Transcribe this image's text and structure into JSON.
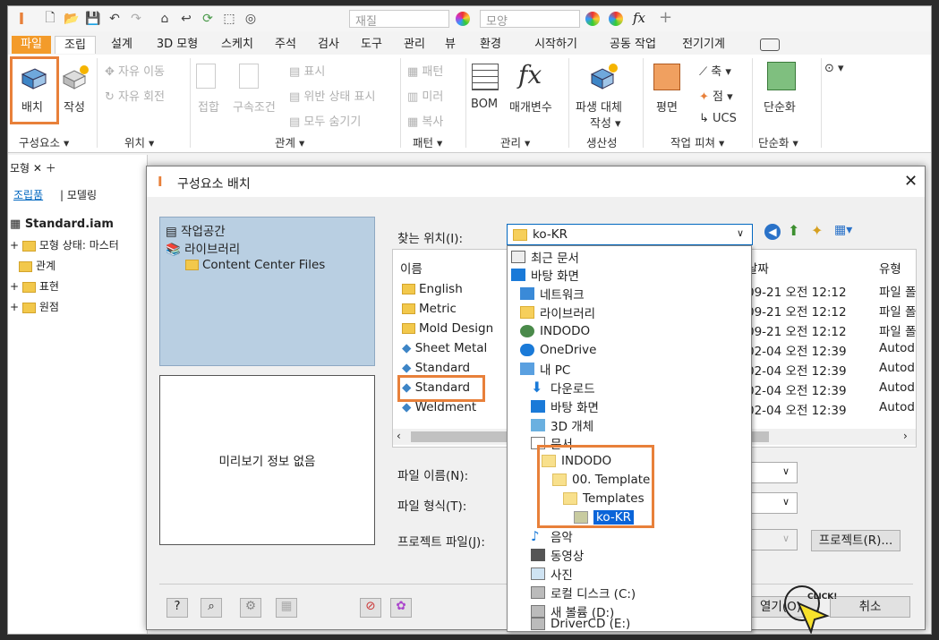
{
  "qat": {
    "material_placeholder": "재질",
    "appearance_placeholder": "모양"
  },
  "tabs": [
    "파일",
    "조립",
    "설계",
    "3D 모형",
    "스케치",
    "주석",
    "검사",
    "도구",
    "관리",
    "뷰",
    "환경",
    "시작하기",
    "공동 작업",
    "전기기계"
  ],
  "ribbon": {
    "place": "배치",
    "create": "작성",
    "free_move": "자유 이동",
    "free_rotate": "자유 회전",
    "joint": "접합",
    "constrain": "구속조건",
    "show": "표시",
    "show_sick": "위반 상태 표시",
    "hide_all": "모두 숨기기",
    "pattern": "패턴",
    "mirror": "미러",
    "copy": "복사",
    "bom": "BOM",
    "params": "매개변수",
    "fx": "fx",
    "derive": "파생 대체",
    "derive2": "작성",
    "plane": "평면",
    "axis": "축",
    "point": "점",
    "ucs": "UCS",
    "simplify": "단순화",
    "groups": {
      "component": "구성요소",
      "position": "위치",
      "relationships": "관계",
      "pattern": "패턴",
      "manage": "관리",
      "productivity": "생산성",
      "work_features": "작업 피쳐",
      "simplification": "단순화"
    }
  },
  "model_panel": {
    "tab": "모형",
    "subtab_assembly": "조립품",
    "subtab_modeling": "모델링",
    "root": "Standard.iam",
    "items": [
      "모형 상태: 마스터",
      "관계",
      "표현",
      "원점"
    ]
  },
  "dialog": {
    "title": "구성요소 배치",
    "places": [
      "작업공간",
      "라이브러리",
      "Content Center Files"
    ],
    "preview_text": "미리보기 정보 없음",
    "look_in_label": "찾는 위치(I):",
    "look_in_value": "ko-KR",
    "columns": {
      "name": "이름",
      "date": "날짜",
      "type": "유형"
    },
    "files": [
      {
        "name": "English",
        "date": "09-21 오전 12:12",
        "type": "파일 폴"
      },
      {
        "name": "Metric",
        "date": "09-21 오전 12:12",
        "type": "파일 폴"
      },
      {
        "name": "Mold Design",
        "date": "09-21 오전 12:12",
        "type": "파일 폴"
      },
      {
        "name": "Sheet Metal",
        "date": "02-04 오전 12:39",
        "type": "Autod"
      },
      {
        "name": "Standard",
        "date": "02-04 오전 12:39",
        "type": "Autod"
      },
      {
        "name": "Standard",
        "date": "02-04 오전 12:39",
        "type": "Autod"
      },
      {
        "name": "Weldment",
        "date": "02-04 오전 12:39",
        "type": "Autod"
      }
    ],
    "filename_label": "파일 이름(N):",
    "filetype_label": "파일 형식(T):",
    "project_label": "프로젝트 파일(J):",
    "project_button": "프로젝트(R)...",
    "open_button": "열기(O)",
    "cancel_button": "취소",
    "click_text": "CLICK!",
    "dropdown_items": [
      "최근 문서",
      "바탕 화면",
      "네트워크",
      "라이브러리",
      "INDODO",
      "OneDrive",
      "내 PC",
      "다운로드",
      "바탕 화면",
      "3D 개체",
      "문서",
      "INDODO",
      "00. Template",
      "Templates",
      "ko-KR",
      "음악",
      "동영상",
      "사진",
      "로컬 디스크 (C:)",
      "새 볼륨 (D:)",
      "DriverCD (E:)"
    ]
  }
}
